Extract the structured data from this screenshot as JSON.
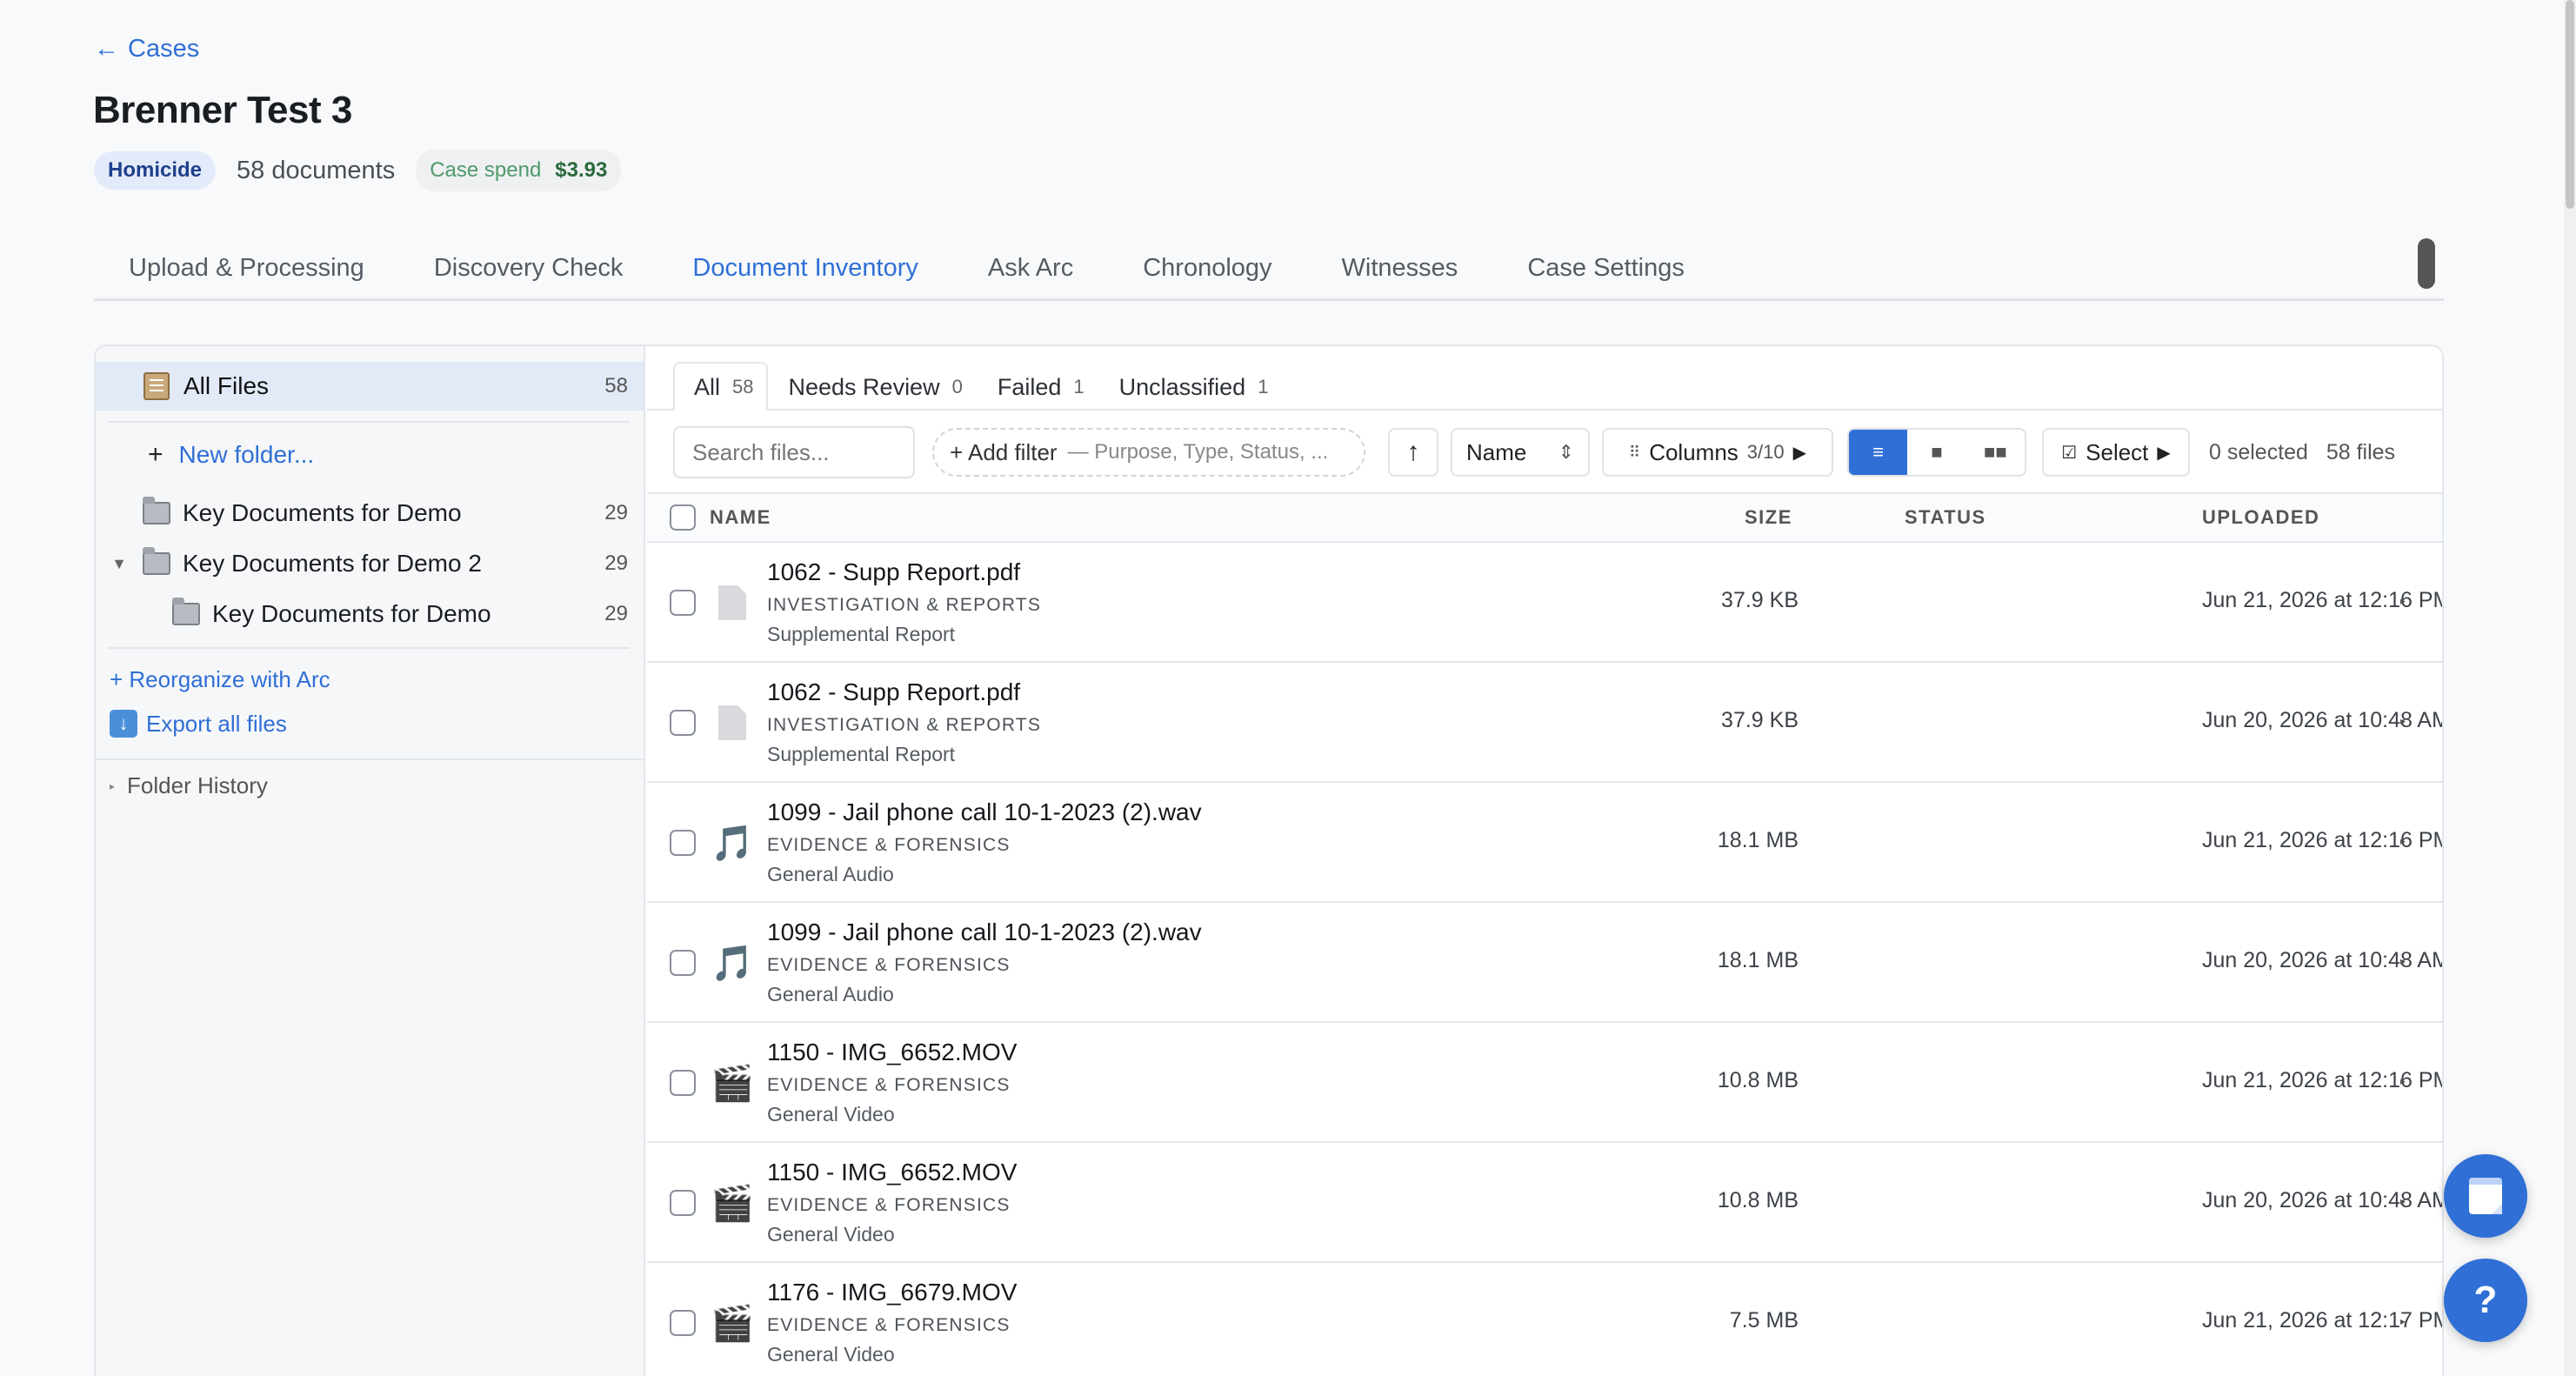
{
  "header": {
    "back_arrow": "←",
    "back_label": "Cases",
    "title": "Brenner Test 3",
    "case_type": "Homicide",
    "doc_count": "58 documents",
    "spend_label": "Case spend",
    "spend_value": "$3.93"
  },
  "tabs": [
    {
      "label": "Upload & Processing"
    },
    {
      "label": "Discovery Check"
    },
    {
      "label": "Document Inventory",
      "active": true
    },
    {
      "label": "Ask Arc"
    },
    {
      "label": "Chronology"
    },
    {
      "label": "Witnesses"
    },
    {
      "label": "Case Settings"
    }
  ],
  "sidebar": {
    "all_files": {
      "label": "All Files",
      "count": "58"
    },
    "new_folder": {
      "plus": "+",
      "label": "New folder..."
    },
    "folders": [
      {
        "label": "Key Documents for Demo",
        "count": "29"
      },
      {
        "label": "Key Documents for Demo 2",
        "count": "29",
        "caret": "▼"
      },
      {
        "label": "Key Documents for Demo",
        "count": "29"
      }
    ],
    "reorganize": "+ Reorganize with Arc",
    "export": "Export all files",
    "folder_history": "Folder History"
  },
  "subtabs": [
    {
      "label": "All",
      "count": "58"
    },
    {
      "label": "Needs Review",
      "count": "0"
    },
    {
      "label": "Failed",
      "count": "1"
    },
    {
      "label": "Unclassified",
      "count": "1"
    }
  ],
  "toolbar": {
    "search_placeholder": "Search files...",
    "add_filter": "+ Add filter",
    "filter_hint": "— Purpose, Type, Status, ...",
    "sort_dir": "↑",
    "sort_value": "Name",
    "sort_arrows": "⇕",
    "columns_label": "Columns",
    "columns_count": "3/10",
    "play": "▶",
    "select_label": "Select",
    "selected": "0 selected",
    "file_count": "58 files"
  },
  "table": {
    "headers": {
      "name": "NAME",
      "size": "SIZE",
      "status": "STATUS",
      "uploaded": "UPLOADED"
    },
    "rows": [
      {
        "icon": "document",
        "name": "1062 - Supp Report.pdf",
        "category": "INVESTIGATION & REPORTS",
        "subtype": "Supplemental Report",
        "size": "37.9 KB",
        "uploaded": "Jun 21, 2026 at 12:16 PM"
      },
      {
        "icon": "document",
        "name": "1062 - Supp Report.pdf",
        "category": "INVESTIGATION & REPORTS",
        "subtype": "Supplemental Report",
        "size": "37.9 KB",
        "uploaded": "Jun 20, 2026 at 10:48 AM"
      },
      {
        "icon": "music",
        "glyph": "🎵",
        "name": "1099 - Jail phone call 10-1-2023 (2).wav",
        "category": "EVIDENCE & FORENSICS",
        "subtype": "General Audio",
        "size": "18.1 MB",
        "uploaded": "Jun 21, 2026 at 12:16 PM"
      },
      {
        "icon": "music",
        "glyph": "🎵",
        "name": "1099 - Jail phone call 10-1-2023 (2).wav",
        "category": "EVIDENCE & FORENSICS",
        "subtype": "General Audio",
        "size": "18.1 MB",
        "uploaded": "Jun 20, 2026 at 10:48 AM"
      },
      {
        "icon": "clapper",
        "glyph": "🎬",
        "name": "1150 - IMG_6652.MOV",
        "category": "EVIDENCE & FORENSICS",
        "subtype": "General Video",
        "size": "10.8 MB",
        "uploaded": "Jun 21, 2026 at 12:16 PM"
      },
      {
        "icon": "clapper",
        "glyph": "🎬",
        "name": "1150 - IMG_6652.MOV",
        "category": "EVIDENCE & FORENSICS",
        "subtype": "General Video",
        "size": "10.8 MB",
        "uploaded": "Jun 20, 2026 at 10:48 AM"
      },
      {
        "icon": "clapper",
        "glyph": "🎬",
        "name": "1176 - IMG_6679.MOV",
        "category": "EVIDENCE & FORENSICS",
        "subtype": "General Video",
        "size": "7.5 MB",
        "uploaded": "Jun 21, 2026 at 12:17 PM"
      }
    ],
    "row_expand": "▸"
  },
  "fab": {
    "help": "?"
  }
}
